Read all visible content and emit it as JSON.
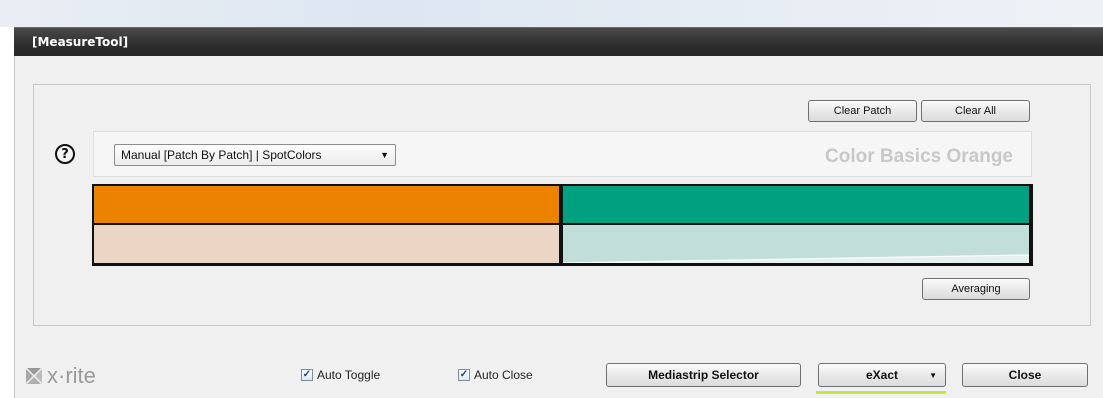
{
  "window": {
    "title": "[MeasureTool]"
  },
  "toolbar": {
    "clear_patch_label": "Clear Patch",
    "clear_all_label": "Clear All"
  },
  "help": {
    "label": "?"
  },
  "mode_select": {
    "value": "Manual [Patch By Patch] | SpotColors"
  },
  "color_set": {
    "name": "Color Basics Orange"
  },
  "patches": [
    {
      "name": "orange",
      "target_color": "#EC8200",
      "measured_color": "#EBD5C4"
    },
    {
      "name": "green",
      "target_color": "#00A080",
      "measured_color": "#C2DED8"
    }
  ],
  "averaging_label": "Averaging",
  "footer": {
    "brand": "x·rite",
    "auto_toggle": {
      "label": "Auto Toggle",
      "checked": true
    },
    "auto_close": {
      "label": "Auto Close",
      "checked": true
    },
    "mediastrip_label": "Mediastrip Selector",
    "device_label": "eXact",
    "close_label": "Close"
  },
  "colors": {
    "titlebar": "#2e2e2e",
    "accent_underline": "#c7e838"
  }
}
